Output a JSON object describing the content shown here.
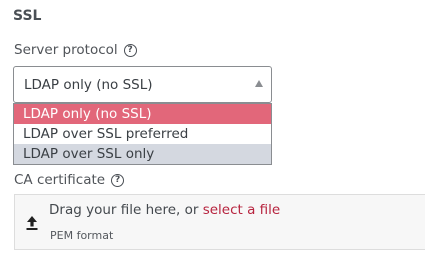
{
  "section": {
    "title": "SSL"
  },
  "server_protocol": {
    "label": "Server protocol",
    "help": "?",
    "selected_value": "LDAP only (no SSL)",
    "options": [
      {
        "label": "LDAP only (no SSL)",
        "state": "selected"
      },
      {
        "label": "LDAP over SSL preferred",
        "state": "normal"
      },
      {
        "label": "LDAP over SSL only",
        "state": "hover"
      }
    ]
  },
  "ca_certificate": {
    "label": "CA certificate",
    "help": "?",
    "drop_prefix": "Drag your file here, or ",
    "drop_link": "select a file",
    "hint": "PEM format"
  },
  "colors": {
    "selected_option": "#e2677a",
    "hover_option": "#d4d8e0",
    "link": "#b7243f"
  },
  "icons": {
    "caret": "caret-up-icon",
    "upload": "upload-icon",
    "help": "help-circle-icon"
  }
}
